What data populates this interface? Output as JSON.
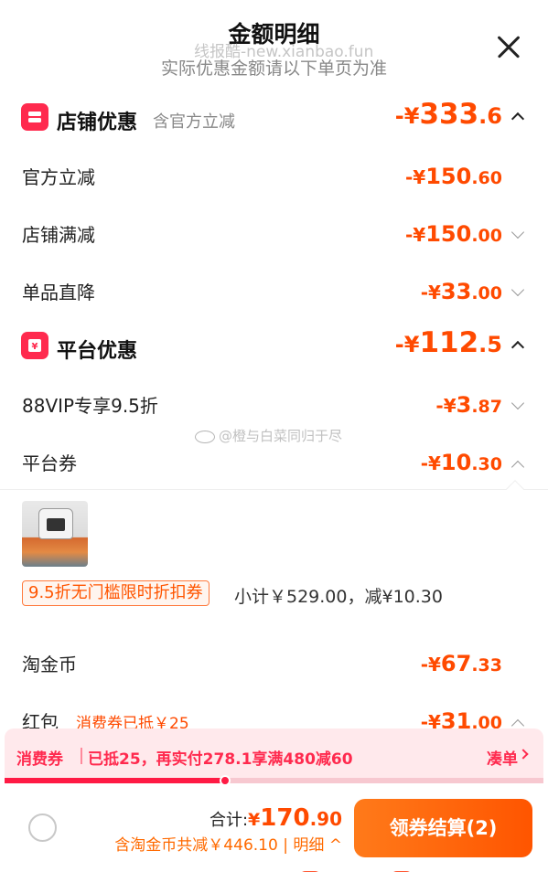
{
  "header": {
    "title": "金额明细",
    "subtitle": "实际优惠金额请以下单页为准",
    "watermark": "线报酷-new.xianbao.fun",
    "close_icon": "close-icon"
  },
  "store_discount": {
    "title": "店铺优惠",
    "sub": "含官方立减",
    "amount": {
      "prefix": "-¥",
      "int": "333",
      "dec": ".6"
    },
    "icon": "store-icon",
    "items": [
      {
        "label": "官方立减",
        "amount": {
          "prefix": "-¥",
          "int": "150",
          "dec": ".60"
        }
      },
      {
        "label": "店铺满减",
        "amount": {
          "prefix": "-¥",
          "int": "150",
          "dec": ".00"
        }
      },
      {
        "label": "单品直降",
        "amount": {
          "prefix": "-¥",
          "int": "33",
          "dec": ".00"
        }
      }
    ]
  },
  "platform_discount": {
    "title": "平台优惠",
    "amount": {
      "prefix": "-¥",
      "int": "112",
      "dec": ".5"
    },
    "icon": "platform-icon",
    "items": [
      {
        "label": "88VIP专享9.5折",
        "amount": {
          "prefix": "-¥",
          "int": "3",
          "dec": ".87"
        }
      },
      {
        "label": "平台券",
        "amount": {
          "prefix": "-¥",
          "int": "10",
          "dec": ".30"
        }
      }
    ]
  },
  "coupon_detail": {
    "tag": "9.5折无门槛限时折扣券",
    "desc": "小计￥529.00，减¥10.30"
  },
  "other_items": [
    {
      "label": "淘金币",
      "amount": {
        "prefix": "-¥",
        "int": "67",
        "dec": ".33"
      }
    },
    {
      "label": "红包",
      "note": "消费券已抵￥25",
      "amount": {
        "prefix": "-¥",
        "int": "31",
        "dec": ".00"
      }
    }
  ],
  "watermark_mid": "@橙与白菜同归于尽",
  "banner": {
    "label": "消费券",
    "text": "已抵25，再实付278.1享满480减60",
    "link": "凑单",
    "progress": 0.41
  },
  "footer": {
    "total_label": "合计:",
    "total": {
      "prefix": "¥",
      "int": "170",
      "dec": ".90"
    },
    "discount_text": "含淘金币共减￥446.10",
    "detail_link": "明细",
    "checkout_label": "领券结算(2)"
  },
  "colors": {
    "accent": "#ff4a00",
    "brand_red": "#ff2a4e",
    "button": "#ff5500"
  }
}
